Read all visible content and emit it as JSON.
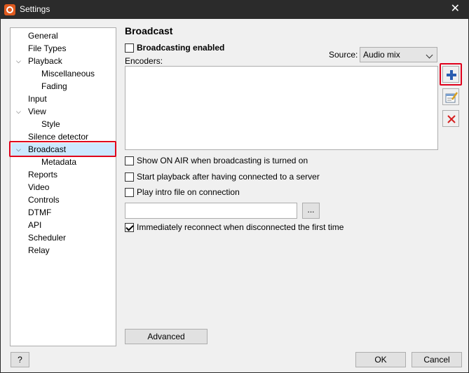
{
  "window": {
    "title": "Settings"
  },
  "sidebar": {
    "items": [
      {
        "label": "General",
        "level": 1,
        "expander": ""
      },
      {
        "label": "File Types",
        "level": 1,
        "expander": ""
      },
      {
        "label": "Playback",
        "level": 1,
        "expander": "expanded"
      },
      {
        "label": "Miscellaneous",
        "level": 2,
        "expander": ""
      },
      {
        "label": "Fading",
        "level": 2,
        "expander": ""
      },
      {
        "label": "Input",
        "level": 1,
        "expander": ""
      },
      {
        "label": "View",
        "level": 1,
        "expander": "expanded"
      },
      {
        "label": "Style",
        "level": 2,
        "expander": ""
      },
      {
        "label": "Silence detector",
        "level": 1,
        "expander": ""
      },
      {
        "label": "Broadcast",
        "level": 1,
        "expander": "expanded",
        "selected": true
      },
      {
        "label": "Metadata",
        "level": 2,
        "expander": ""
      },
      {
        "label": "Reports",
        "level": 1,
        "expander": ""
      },
      {
        "label": "Video",
        "level": 1,
        "expander": ""
      },
      {
        "label": "Controls",
        "level": 1,
        "expander": ""
      },
      {
        "label": "DTMF",
        "level": 1,
        "expander": ""
      },
      {
        "label": "API",
        "level": 1,
        "expander": ""
      },
      {
        "label": "Scheduler",
        "level": 1,
        "expander": ""
      },
      {
        "label": "Relay",
        "level": 1,
        "expander": ""
      }
    ]
  },
  "main": {
    "title": "Broadcast",
    "broadcasting_enabled": {
      "label": "Broadcasting enabled",
      "checked": false
    },
    "source": {
      "label": "Source:",
      "value": "Audio mix"
    },
    "encoders_label": "Encoders:",
    "encoders": [],
    "options": [
      {
        "label": "Show ON AIR when broadcasting is turned on",
        "checked": false
      },
      {
        "label": "Start playback after having connected to a server",
        "checked": false
      },
      {
        "label": "Play intro file on connection",
        "checked": false
      }
    ],
    "intro_file": {
      "value": "",
      "browse_label": "..."
    },
    "reconnect": {
      "label": "Immediately reconnect when disconnected the first time",
      "checked": true
    },
    "advanced_label": "Advanced"
  },
  "footer": {
    "help_label": "?",
    "ok_label": "OK",
    "cancel_label": "Cancel"
  },
  "colors": {
    "highlight": "#e0001b",
    "titlebar": "#2b2b2b",
    "selection": "#cce8ff"
  }
}
